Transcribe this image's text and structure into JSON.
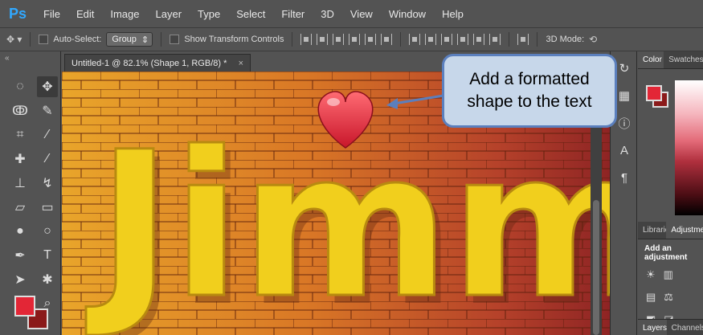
{
  "app": {
    "logo": "Ps"
  },
  "menu": [
    "File",
    "Edit",
    "Image",
    "Layer",
    "Type",
    "Select",
    "Filter",
    "3D",
    "View",
    "Window",
    "Help"
  ],
  "options": {
    "auto_select_label": "Auto-Select:",
    "auto_select_value": "Group",
    "transform_label": "Show Transform Controls",
    "mode_label": "3D Mode:"
  },
  "document": {
    "tab_title": "Untitled-1 @ 82.1% (Shape 1, RGB/8) *",
    "close": "×"
  },
  "canvas": {
    "text": "Jimmy"
  },
  "callout": {
    "line1": "Add a formatted",
    "line2": "shape to the text"
  },
  "panels": {
    "color_tab": "Color",
    "swatches_tab": "Swatches",
    "libraries_tab": "Libraries",
    "adjust_tab": "Adjustments",
    "adjust_head": "Add an adjustment",
    "layers_tab": "Layers",
    "channels_tab": "Channels"
  },
  "colors": {
    "foreground": "#e32636",
    "background": "#8b1a1a",
    "accent": "#31a8ff"
  }
}
